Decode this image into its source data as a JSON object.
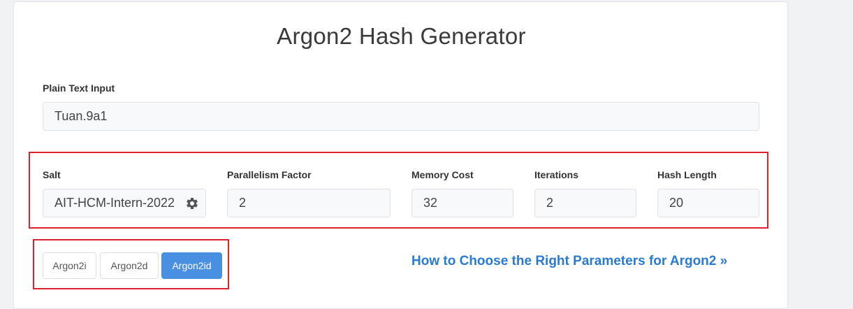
{
  "title": "Argon2 Hash Generator",
  "plain_text": {
    "label": "Plain Text Input",
    "value": "Tuan.9a1"
  },
  "params": {
    "salt": {
      "label": "Salt",
      "value": "AIT-HCM-Intern-2022"
    },
    "parallelism": {
      "label": "Parallelism Factor",
      "value": "2"
    },
    "memory": {
      "label": "Memory Cost",
      "value": "32"
    },
    "iterations": {
      "label": "Iterations",
      "value": "2"
    },
    "hash_length": {
      "label": "Hash Length",
      "value": "20"
    }
  },
  "variants": [
    {
      "label": "Argon2i",
      "active": false
    },
    {
      "label": "Argon2d",
      "active": false
    },
    {
      "label": "Argon2id",
      "active": true
    }
  ],
  "help_link": "How to Choose the Right Parameters for Argon2 »",
  "icons": {
    "salt_generate": "gear-icon"
  },
  "colors": {
    "accent": "#4a90e2",
    "highlight": "#d9232e",
    "link": "#2a7bd0"
  }
}
